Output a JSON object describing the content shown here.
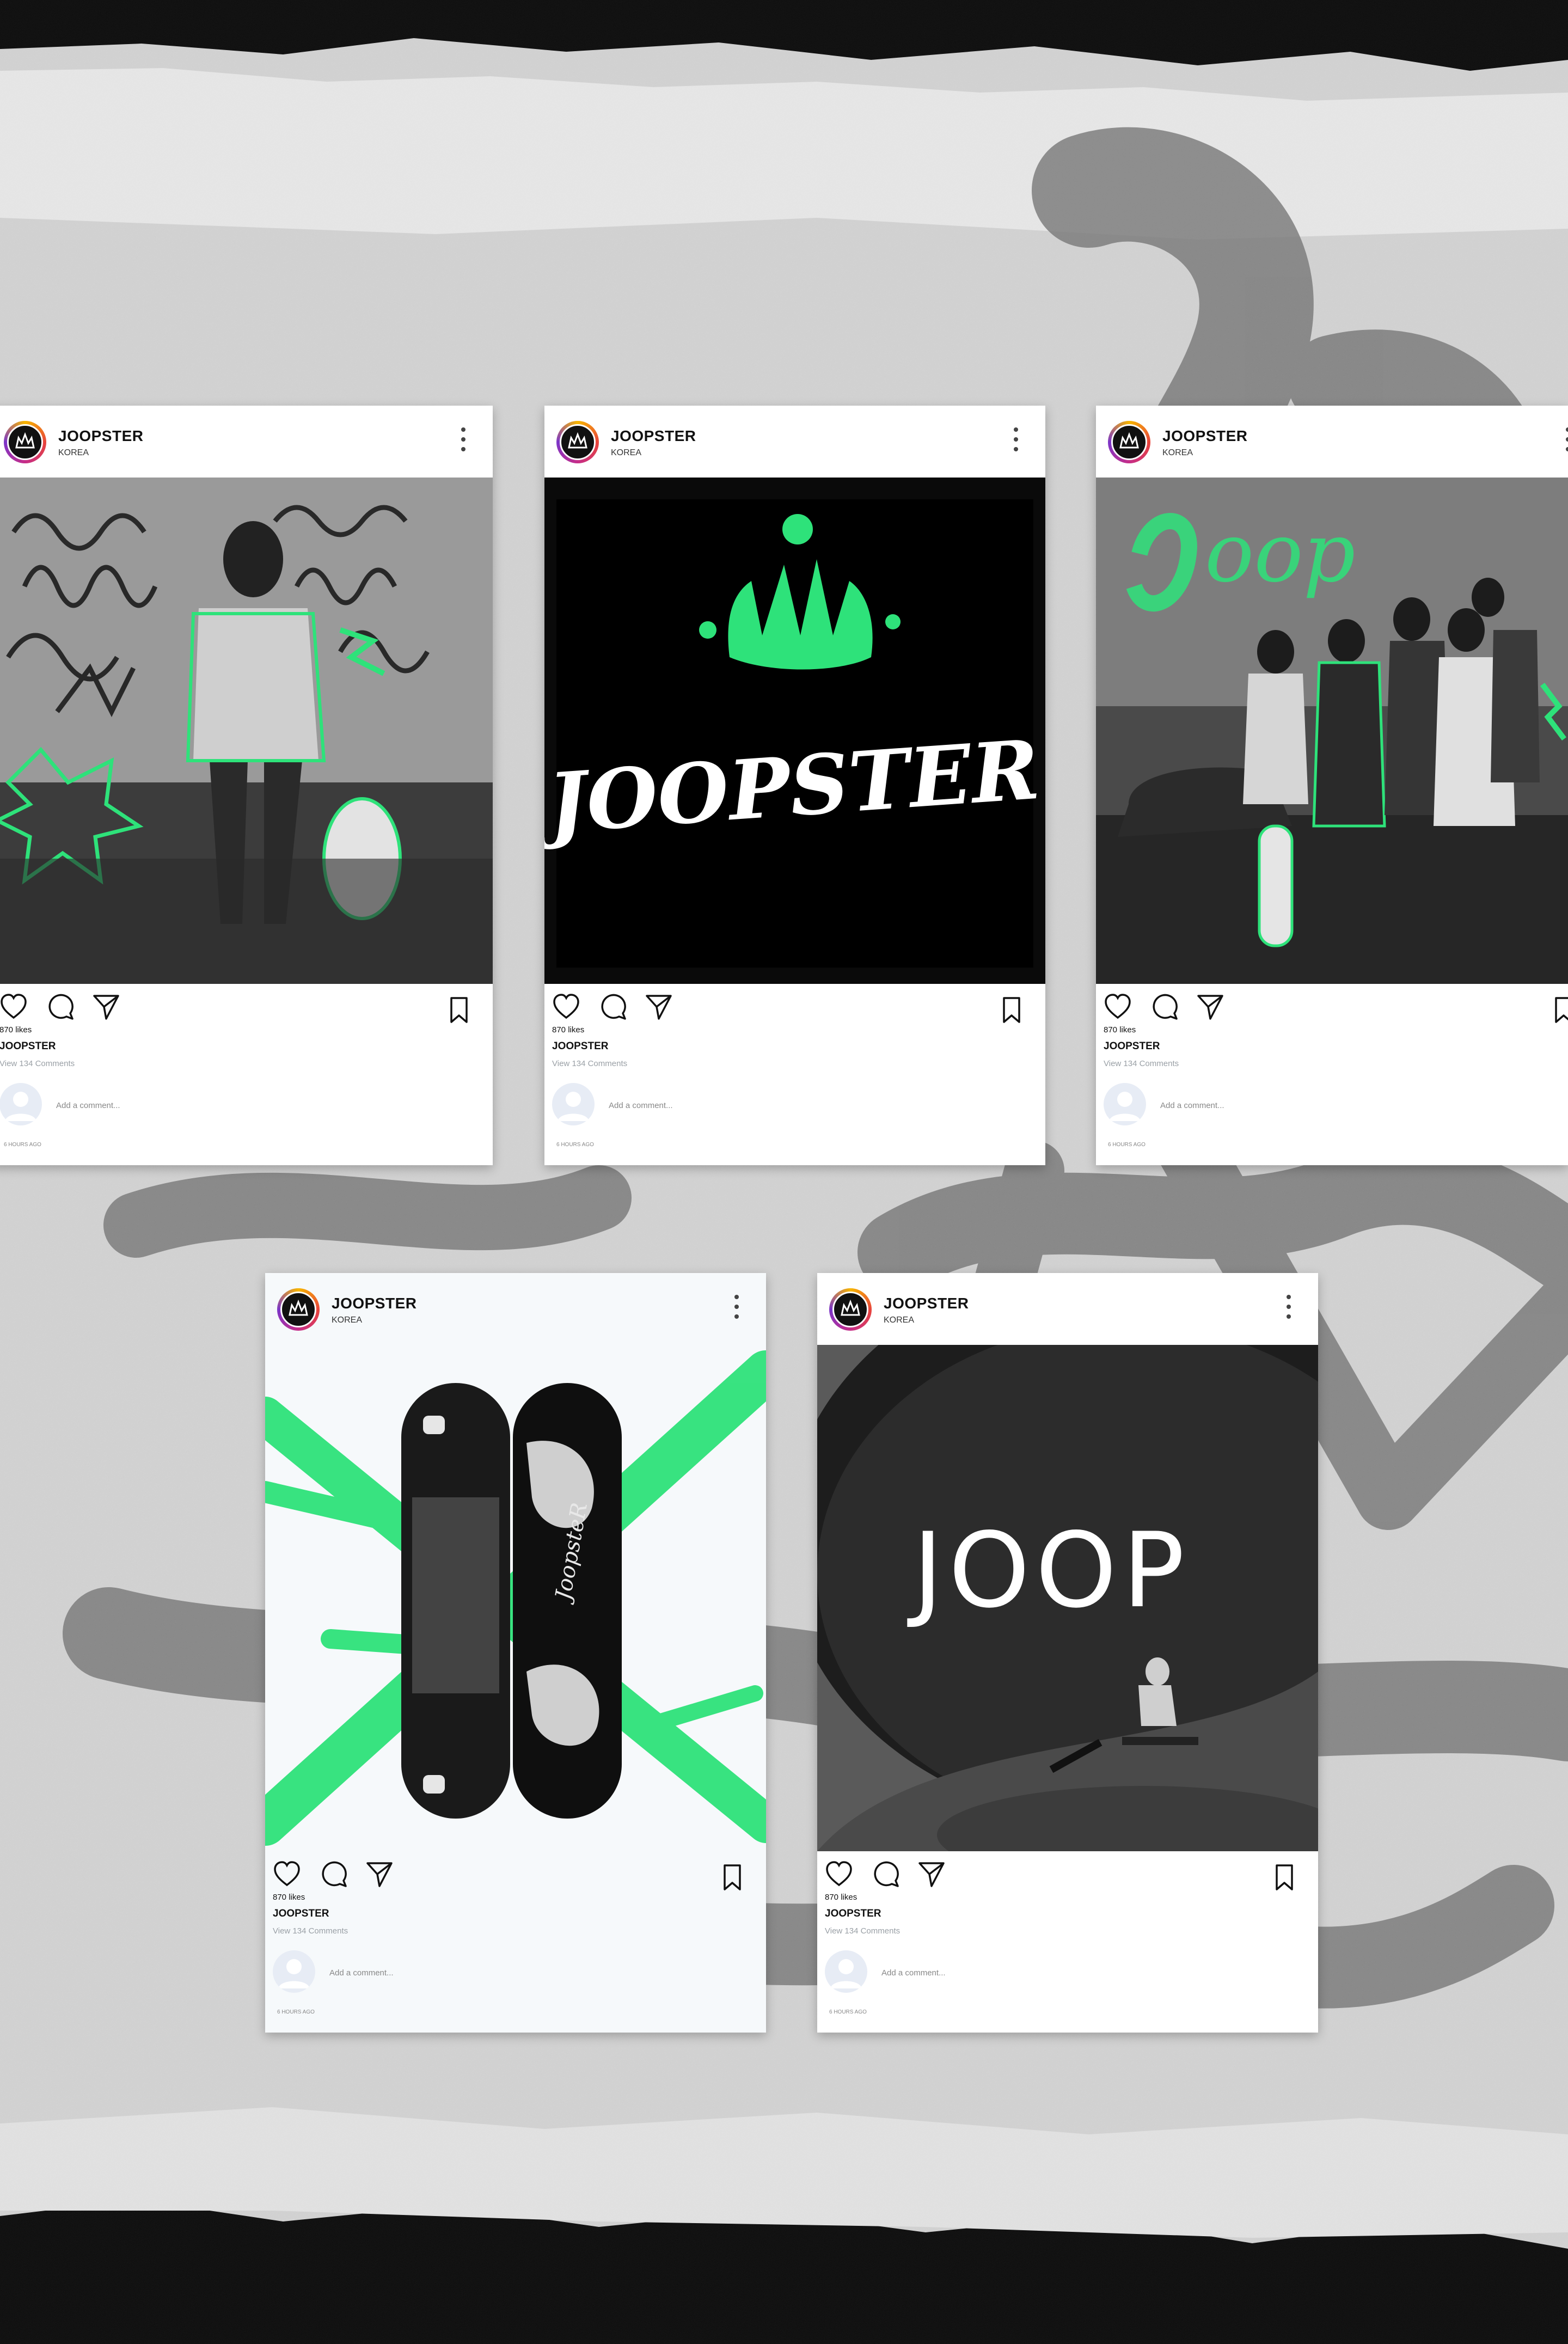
{
  "colors": {
    "accent_green": "#2ee27a",
    "page_background": "#0b0b0b",
    "paper": "#d2d2d2",
    "card_background": "#ffffff"
  },
  "posts": [
    {
      "username": "JOOPSTER",
      "location": "KOREA",
      "media": "graffiti-wall-photo",
      "likes": "870 likes",
      "caption_user": "JOOPSTER",
      "view_comments": "View 134 Comments",
      "comment_placeholder": "Add a comment...",
      "time_ago": "6 HOURS AGO",
      "icons": [
        "heart-icon",
        "comment-icon",
        "send-icon",
        "bookmark-icon",
        "more-icon"
      ]
    },
    {
      "username": "JOOPSTER",
      "location": "KOREA",
      "media": "crown-logo",
      "logo_wordmark": "JOOPSTER",
      "likes": "870 likes",
      "caption_user": "JOOPSTER",
      "view_comments": "View 134 Comments",
      "comment_placeholder": "Add a comment...",
      "time_ago": "6 HOURS AGO"
    },
    {
      "username": "JOOPSTER",
      "location": "KOREA",
      "media": "group-photo",
      "likes": "870 likes",
      "caption_user": "JOOPSTER",
      "view_comments": "View 134 Comments",
      "comment_placeholder": "Add a comment...",
      "time_ago": "6 HOURS AGO"
    },
    {
      "username": "JOOPSTER",
      "location": "KOREA",
      "media": "skateboard-decks",
      "likes": "870 likes",
      "caption_user": "JOOPSTER",
      "view_comments": "View 134 Comments",
      "comment_placeholder": "Add a comment...",
      "time_ago": "6 HOURS AGO"
    },
    {
      "username": "JOOPSTER",
      "location": "KOREA",
      "media": "skate-bowl-photo",
      "overlay_text": "JOOP",
      "likes": "870 likes",
      "caption_user": "JOOPSTER",
      "view_comments": "View 134 Comments",
      "comment_placeholder": "Add a comment...",
      "time_ago": "6 HOURS AGO"
    }
  ]
}
